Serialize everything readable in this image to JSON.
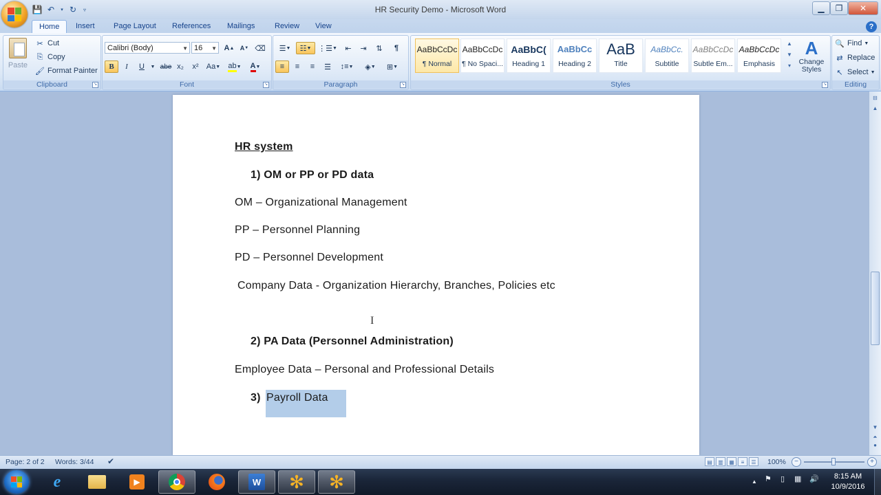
{
  "window": {
    "title": "HR Security Demo - Microsoft Word",
    "minimize_icon": "minimize-icon",
    "maximize_icon": "restore-icon",
    "close_icon": "close-icon"
  },
  "qat": {
    "save_icon": "save-icon",
    "undo_icon": "undo-icon",
    "redo_icon": "redo-icon"
  },
  "tabs": [
    {
      "label": "Home",
      "active": true
    },
    {
      "label": "Insert"
    },
    {
      "label": "Page Layout"
    },
    {
      "label": "References"
    },
    {
      "label": "Mailings"
    },
    {
      "label": "Review"
    },
    {
      "label": "View"
    }
  ],
  "clipboard": {
    "label": "Clipboard",
    "paste": "Paste",
    "cut": "Cut",
    "copy": "Copy",
    "format_painter": "Format Painter"
  },
  "font": {
    "label": "Font",
    "family": "Calibri (Body)",
    "size": "16",
    "bold": "B",
    "italic": "I",
    "underline": "U",
    "strike": "abe",
    "subscript": "x₂",
    "superscript": "x²",
    "change_case": "Aa",
    "grow": "A",
    "shrink": "A"
  },
  "paragraph": {
    "label": "Paragraph"
  },
  "styles": {
    "label": "Styles",
    "items": [
      {
        "preview": "AaBbCcDc",
        "name": "¶ Normal",
        "selected": true
      },
      {
        "preview": "AaBbCcDc",
        "name": "¶ No Spaci..."
      },
      {
        "preview": "AaBbC(",
        "name": "Heading 1"
      },
      {
        "preview": "AaBbCc",
        "name": "Heading 2"
      },
      {
        "preview": "AaB",
        "name": "Title"
      },
      {
        "preview": "AaBbCc.",
        "name": "Subtitle"
      },
      {
        "preview": "AaBbCcDc",
        "name": "Subtle Em..."
      },
      {
        "preview": "AaBbCcDc",
        "name": "Emphasis"
      }
    ],
    "change_styles": "Change Styles"
  },
  "editing": {
    "label": "Editing",
    "find": "Find",
    "replace": "Replace",
    "select": "Select"
  },
  "document": {
    "heading": "HR system",
    "item1": "1)  OM or PP or PD data",
    "om": "OM – Organizational  Management",
    "pp": "PP – Personnel  Planning",
    "pd": "PD – Personnel  Development",
    "company": "Company  Data  -  Organization  Hierarchy,  Branches,  Policies  etc",
    "item2": "2)  PA Data  (Personnel  Administration)",
    "employee": "Employee  Data  –  Personal  and  Professional  Details",
    "item3_num": "3)",
    "item3_text": "Payroll  Data"
  },
  "status": {
    "page": "Page: 2 of 2",
    "words": "Words: 3/44",
    "zoom": "100%"
  },
  "taskbar": {
    "clock_time": "8:15 AM",
    "clock_date": "10/9/2016"
  },
  "colors": {
    "ribbon_text": "#15428b",
    "selection": "#b3cde9",
    "taskbar": "#1a2538"
  }
}
